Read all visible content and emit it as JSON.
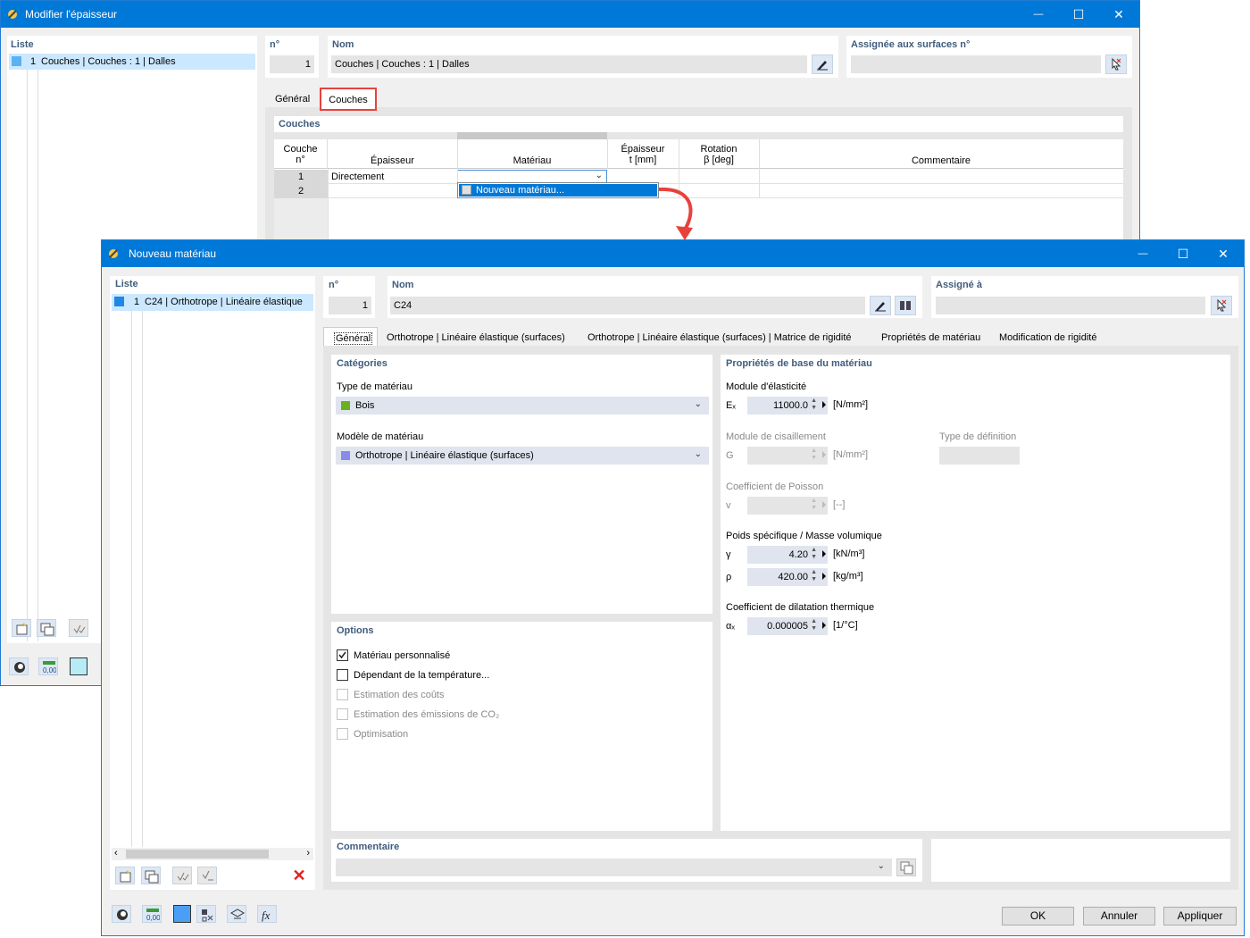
{
  "bg_window": {
    "title": "Modifier l'épaisseur",
    "controls": {
      "minimize": "—",
      "maximize": "☐",
      "close": "✕"
    },
    "list_label": "Liste",
    "list_items": [
      {
        "num": "1",
        "text": "Couches | Couches : 1 | Dalles"
      }
    ],
    "no_label": "n°",
    "no_value": "1",
    "name_label": "Nom",
    "name_value": "Couches | Couches : 1 | Dalles",
    "assigned_label": "Assignée aux surfaces n°",
    "assigned_value": "",
    "tabs": [
      "Général",
      "Couches"
    ],
    "active_tab": "Couches",
    "highlight_color": "#e8413c",
    "section_title": "Couches",
    "table": {
      "headers": {
        "layer": [
          "Couche",
          "n°"
        ],
        "thickness": "Épaisseur",
        "material": "Matériau",
        "thick_mm": [
          "Épaisseur",
          "t [mm]"
        ],
        "rotation": [
          "Rotation",
          "β [deg]"
        ],
        "comment": "Commentaire"
      },
      "rows": [
        {
          "num": "1",
          "thickness": "Directement",
          "material": ""
        },
        {
          "num": "2",
          "thickness": "",
          "material": ""
        }
      ]
    },
    "dropdown_option": "Nouveau matériau..."
  },
  "fg_window": {
    "title": "Nouveau matériau",
    "controls": {
      "minimize": "—",
      "maximize": "☐",
      "close": "✕"
    },
    "list_label": "Liste",
    "list_items": [
      {
        "num": "1",
        "text": "C24 | Orthotrope | Linéaire élastique"
      }
    ],
    "no_label": "n°",
    "no_value": "1",
    "name_label": "Nom",
    "name_value": "C24",
    "assigned_label": "Assigné à",
    "assigned_value": "",
    "tabs": [
      "Général",
      "Orthotrope | Linéaire élastique (surfaces)",
      "Orthotrope | Linéaire élastique (surfaces) | Matrice de rigidité",
      "Propriétés de matériau",
      "Modification de rigidité"
    ],
    "active_tab": "Général",
    "categories": {
      "title": "Catégories",
      "type_label": "Type de matériau",
      "type_value": "Bois",
      "type_color": "#6bb01e",
      "model_label": "Modèle de matériau",
      "model_value": "Orthotrope | Linéaire élastique (surfaces)",
      "model_color": "#8a8ae8"
    },
    "options": {
      "title": "Options",
      "items": [
        {
          "label": "Matériau personnalisé",
          "checked": true,
          "enabled": true
        },
        {
          "label": "Dépendant de la température...",
          "checked": false,
          "enabled": true
        },
        {
          "label": "Estimation des coûts",
          "checked": false,
          "enabled": false
        },
        {
          "label": "Estimation des émissions de CO₂",
          "checked": false,
          "enabled": false
        },
        {
          "label": "Optimisation",
          "checked": false,
          "enabled": false
        }
      ]
    },
    "props": {
      "title": "Propriétés de base du matériau",
      "elasticity_label": "Module d'élasticité",
      "e_symbol": "Eₓ",
      "e_value": "11000.0",
      "e_unit": "[N/mm²]",
      "shear_label": "Module de cisaillement",
      "g_symbol": "G",
      "g_value": "",
      "g_unit": "[N/mm²]",
      "def_type_label": "Type de définition",
      "poisson_label": "Coefficient de Poisson",
      "v_symbol": "v",
      "v_value": "",
      "v_unit": "[--]",
      "weight_label": "Poids spécifique / Masse volumique",
      "gamma_symbol": "γ",
      "gamma_value": "4.20",
      "gamma_unit": "[kN/m³]",
      "rho_symbol": "ρ",
      "rho_value": "420.00",
      "rho_unit": "[kg/m³]",
      "thermal_label": "Coefficient de dilatation thermique",
      "alpha_symbol": "αₓ",
      "alpha_value": "0.000005",
      "alpha_unit": "[1/°C]"
    },
    "comment_label": "Commentaire",
    "comment_value": "",
    "buttons": {
      "ok": "OK",
      "cancel": "Annuler",
      "apply": "Appliquer"
    },
    "bottom_swatch_color": "#4a9ff5"
  }
}
